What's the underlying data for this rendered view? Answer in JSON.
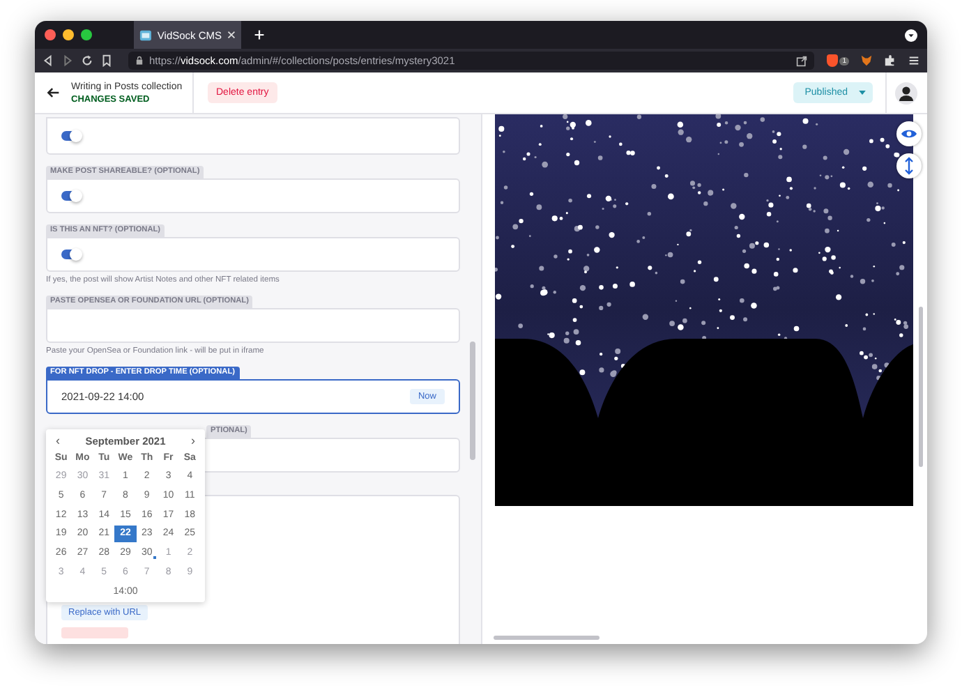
{
  "browser": {
    "tab_title": "VidSock CMS",
    "url_prefix": "https://",
    "url_host": "vidsock.com",
    "url_path": "/admin/#/collections/posts/entries/mystery3021",
    "extension_badge": "1"
  },
  "header": {
    "title": "Writing in Posts collection",
    "status": "CHANGES SAVED",
    "delete_button": "Delete entry",
    "publish_button": "Published"
  },
  "fields": [
    {
      "kind": "toggle",
      "on": true
    },
    {
      "kind": "toggle",
      "label": "MAKE POST SHAREABLE? (OPTIONAL)",
      "on": true
    },
    {
      "kind": "toggle",
      "label": "IS THIS AN NFT? (OPTIONAL)",
      "on": true,
      "hint": "If yes, the post will show Artist Notes and other NFT related items"
    },
    {
      "kind": "text",
      "label": "PASTE OPENSEA OR FOUNDATION URL (OPTIONAL)",
      "hint": "Paste your OpenSea or Foundation link - will be put in iframe",
      "focused": false
    },
    {
      "kind": "datetime",
      "label": "FOR NFT DROP - ENTER DROP TIME (OPTIONAL)",
      "value": "2021-09-22 14:00",
      "button": "Now",
      "focused": true
    },
    {
      "kind": "text",
      "label": "PTIONAL)",
      "focused": false
    },
    {
      "kind": "media",
      "buttons": [
        "Replace with URL"
      ]
    }
  ],
  "calendar": {
    "prev": "‹",
    "month": "September 2021",
    "next": "›",
    "weekdays": [
      "Su",
      "Mo",
      "Tu",
      "We",
      "Th",
      "Fr",
      "Sa"
    ],
    "weeks": [
      [
        {
          "d": "29",
          "muted": true,
          "selected": false,
          "today": false
        },
        {
          "d": "30",
          "muted": true,
          "selected": false,
          "today": false
        },
        {
          "d": "31",
          "muted": true,
          "selected": false,
          "today": false
        },
        {
          "d": "1",
          "muted": false,
          "selected": false,
          "today": false
        },
        {
          "d": "2",
          "muted": false,
          "selected": false,
          "today": false
        },
        {
          "d": "3",
          "muted": false,
          "selected": false,
          "today": false
        },
        {
          "d": "4",
          "muted": false,
          "selected": false,
          "today": false
        }
      ],
      [
        {
          "d": "5",
          "muted": false,
          "selected": false,
          "today": false
        },
        {
          "d": "6",
          "muted": false,
          "selected": false,
          "today": false
        },
        {
          "d": "7",
          "muted": false,
          "selected": false,
          "today": false
        },
        {
          "d": "8",
          "muted": false,
          "selected": false,
          "today": false
        },
        {
          "d": "9",
          "muted": false,
          "selected": false,
          "today": false
        },
        {
          "d": "10",
          "muted": false,
          "selected": false,
          "today": false
        },
        {
          "d": "11",
          "muted": false,
          "selected": false,
          "today": false
        }
      ],
      [
        {
          "d": "12",
          "muted": false,
          "selected": false,
          "today": false
        },
        {
          "d": "13",
          "muted": false,
          "selected": false,
          "today": false
        },
        {
          "d": "14",
          "muted": false,
          "selected": false,
          "today": false
        },
        {
          "d": "15",
          "muted": false,
          "selected": false,
          "today": false
        },
        {
          "d": "16",
          "muted": false,
          "selected": false,
          "today": false
        },
        {
          "d": "17",
          "muted": false,
          "selected": false,
          "today": false
        },
        {
          "d": "18",
          "muted": false,
          "selected": false,
          "today": false
        }
      ],
      [
        {
          "d": "19",
          "muted": false,
          "selected": false,
          "today": false
        },
        {
          "d": "20",
          "muted": false,
          "selected": false,
          "today": false
        },
        {
          "d": "21",
          "muted": false,
          "selected": false,
          "today": false
        },
        {
          "d": "22",
          "muted": false,
          "selected": true,
          "today": false
        },
        {
          "d": "23",
          "muted": false,
          "selected": false,
          "today": false
        },
        {
          "d": "24",
          "muted": false,
          "selected": false,
          "today": false
        },
        {
          "d": "25",
          "muted": false,
          "selected": false,
          "today": false
        }
      ],
      [
        {
          "d": "26",
          "muted": false,
          "selected": false,
          "today": false
        },
        {
          "d": "27",
          "muted": false,
          "selected": false,
          "today": false
        },
        {
          "d": "28",
          "muted": false,
          "selected": false,
          "today": false
        },
        {
          "d": "29",
          "muted": false,
          "selected": false,
          "today": false
        },
        {
          "d": "30",
          "muted": false,
          "selected": false,
          "today": true
        },
        {
          "d": "1",
          "muted": true,
          "selected": false,
          "today": false
        },
        {
          "d": "2",
          "muted": true,
          "selected": false,
          "today": false
        }
      ],
      [
        {
          "d": "3",
          "muted": true,
          "selected": false,
          "today": false
        },
        {
          "d": "4",
          "muted": true,
          "selected": false,
          "today": false
        },
        {
          "d": "5",
          "muted": true,
          "selected": false,
          "today": false
        },
        {
          "d": "6",
          "muted": true,
          "selected": false,
          "today": false
        },
        {
          "d": "7",
          "muted": true,
          "selected": false,
          "today": false
        },
        {
          "d": "8",
          "muted": true,
          "selected": false,
          "today": false
        },
        {
          "d": "9",
          "muted": true,
          "selected": false,
          "today": false
        }
      ]
    ],
    "time": "14:00"
  }
}
